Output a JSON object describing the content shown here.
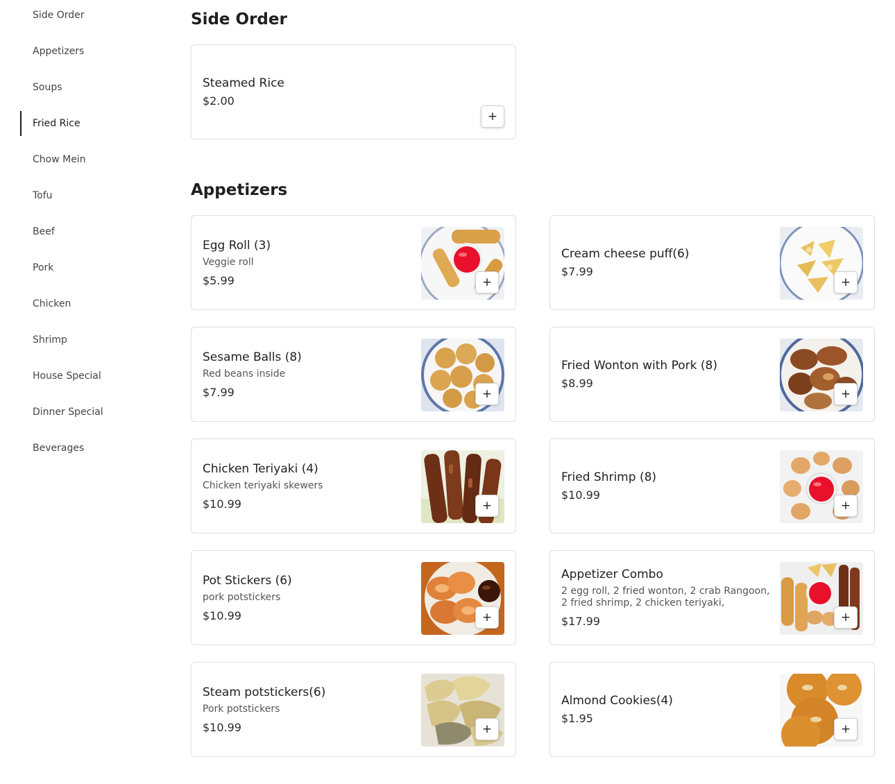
{
  "sidebar": {
    "items": [
      {
        "label": "Side Order"
      },
      {
        "label": "Appetizers"
      },
      {
        "label": "Soups"
      },
      {
        "label": "Fried Rice",
        "active": true
      },
      {
        "label": "Chow Mein"
      },
      {
        "label": "Tofu"
      },
      {
        "label": "Beef"
      },
      {
        "label": "Pork"
      },
      {
        "label": "Chicken"
      },
      {
        "label": "Shrimp"
      },
      {
        "label": "House Special"
      },
      {
        "label": "Dinner Special"
      },
      {
        "label": "Beverages"
      }
    ]
  },
  "sections": {
    "side_order": {
      "title": "Side Order",
      "items": [
        {
          "name": "Steamed Rice",
          "price": "$2.00"
        }
      ]
    },
    "appetizers": {
      "title": "Appetizers",
      "items": [
        {
          "name": "Egg Roll (3)",
          "desc": "Veggie roll",
          "price": "$5.99",
          "image": "egg-roll-photo"
        },
        {
          "name": "Cream cheese puff(6)",
          "price": "$7.99",
          "image": "cream-cheese-puff-photo"
        },
        {
          "name": "Sesame Balls (8)",
          "desc": "Red beans inside",
          "price": "$7.99",
          "image": "sesame-balls-photo"
        },
        {
          "name": "Fried Wonton with Pork (8)",
          "price": "$8.99",
          "image": "fried-wonton-photo"
        },
        {
          "name": "Chicken Teriyaki (4)",
          "desc": "Chicken teriyaki skewers",
          "price": "$10.99",
          "image": "chicken-teriyaki-photo"
        },
        {
          "name": "Fried Shrimp (8)",
          "price": "$10.99",
          "image": "fried-shrimp-photo"
        },
        {
          "name": "Pot Stickers (6)",
          "desc": "pork potstickers",
          "price": "$10.99",
          "image": "pot-stickers-photo"
        },
        {
          "name": "Appetizer Combo",
          "desc": "2 egg roll, 2 fried wonton, 2 crab Rangoon, 2 fried shrimp, 2 chicken teriyaki,",
          "price": "$17.99",
          "image": "appetizer-combo-photo"
        },
        {
          "name": "Steam potstickers(6)",
          "desc": "Pork potstickers",
          "price": "$10.99",
          "image": "steam-potstickers-photo"
        },
        {
          "name": "Almond Cookies(4)",
          "price": "$1.95",
          "image": "almond-cookies-photo"
        }
      ]
    }
  },
  "buttons": {
    "add_label": "+"
  },
  "icons": {
    "add": "plus-icon"
  }
}
